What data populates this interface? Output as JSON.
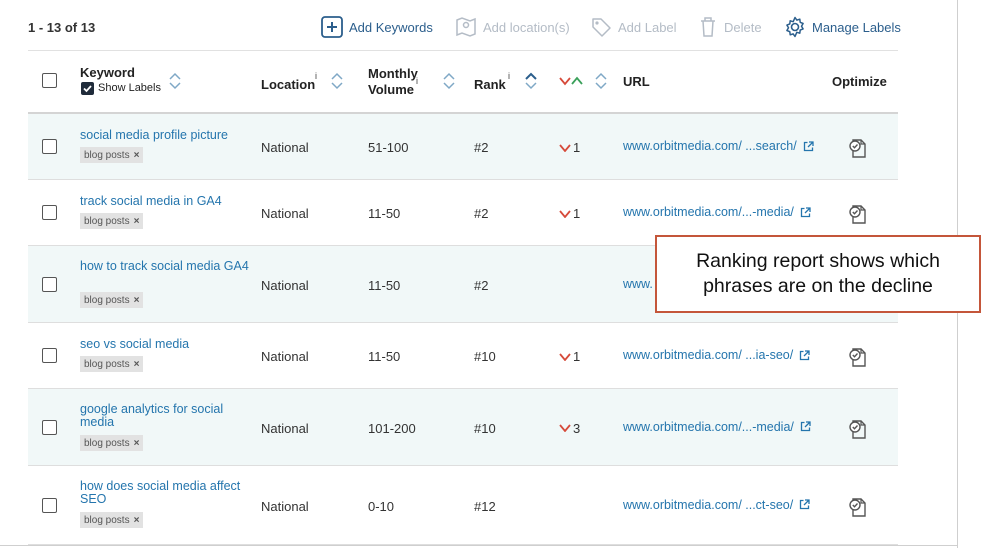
{
  "toolbar": {
    "count": "1 - 13 of 13",
    "add_keywords": "Add Keywords",
    "add_location": "Add location(s)",
    "add_label": "Add Label",
    "delete": "Delete",
    "manage_labels": "Manage Labels"
  },
  "table": {
    "headers": {
      "keyword": "Keyword",
      "show_labels": "Show Labels",
      "location": "Location",
      "location_info": "i",
      "monthly_line1": "Monthly",
      "monthly_line2": "Volume",
      "monthly_info": "i",
      "rank": "Rank",
      "rank_info": "i",
      "url": "URL",
      "optimize": "Optimize"
    },
    "rows": [
      {
        "keyword": "social media profile picture",
        "label": "blog posts",
        "location": "National",
        "volume": "51-100",
        "rank": "#2",
        "change": "1",
        "direction": "down",
        "url": "www.orbitmedia.com/ ...search/"
      },
      {
        "keyword": "track social media in GA4",
        "label": "blog posts",
        "location": "National",
        "volume": "11-50",
        "rank": "#2",
        "change": "1",
        "direction": "down",
        "url": "www.orbitmedia.com/...-media/"
      },
      {
        "keyword": "how to track social media GA4",
        "label": "blog posts",
        "location": "National",
        "volume": "11-50",
        "rank": "#2",
        "change": "",
        "direction": "none",
        "url": "www."
      },
      {
        "keyword": "seo vs social media",
        "label": "blog posts",
        "location": "National",
        "volume": "11-50",
        "rank": "#10",
        "change": "1",
        "direction": "down",
        "url": "www.orbitmedia.com/ ...ia-seo/"
      },
      {
        "keyword": "google analytics for social media",
        "label": "blog posts",
        "location": "National",
        "volume": "101-200",
        "rank": "#10",
        "change": "3",
        "direction": "down",
        "url": "www.orbitmedia.com/...-media/"
      },
      {
        "keyword": "how does social media affect SEO",
        "label": "blog posts",
        "location": "National",
        "volume": "0-10",
        "rank": "#12",
        "change": "",
        "direction": "none",
        "url": "www.orbitmedia.com/ ...ct-seo/"
      }
    ]
  },
  "callout": {
    "text": "Ranking report shows which phrases are on the decline"
  },
  "colors": {
    "link": "#2475ad",
    "down": "#d64a3a",
    "up": "#3aa05a",
    "callout_border": "#c4563a",
    "row_alt": "#f1f8f8"
  }
}
